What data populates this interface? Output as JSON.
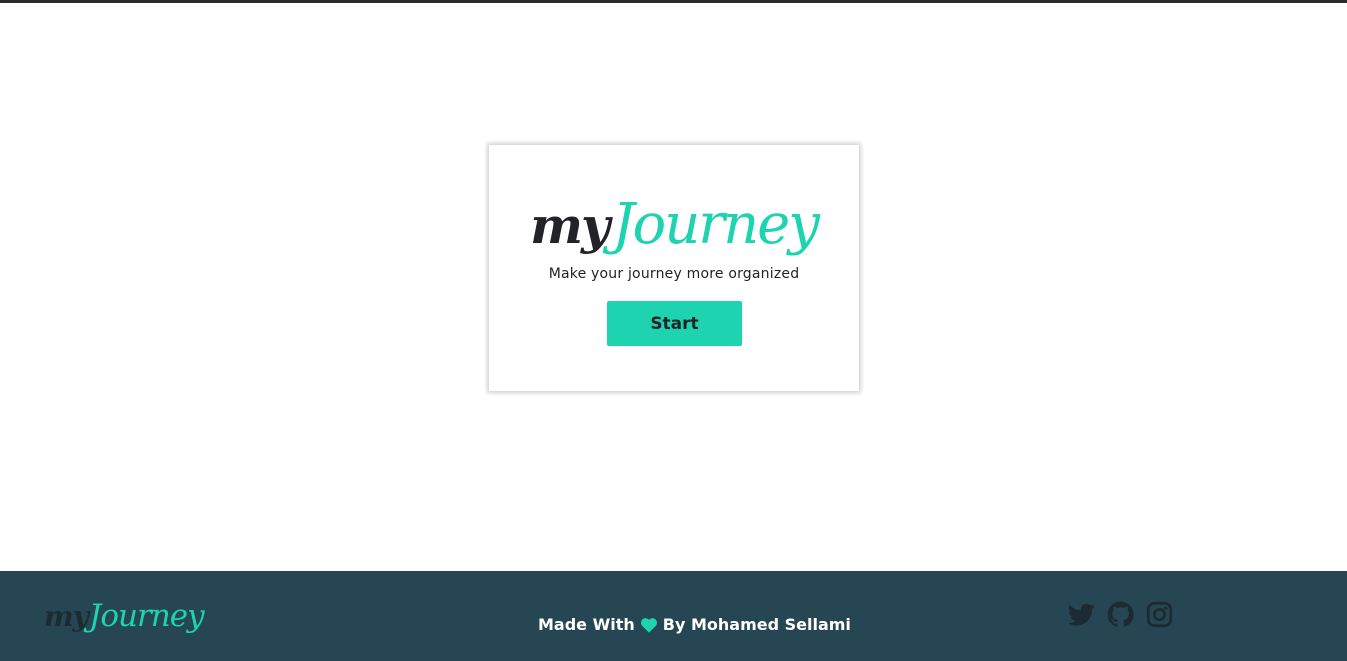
{
  "hero": {
    "logo_my": "my",
    "logo_journey": "Journey",
    "tagline": "Make your journey more organized",
    "start_label": "Start"
  },
  "footer": {
    "logo_my": "my",
    "logo_journey": "Journey",
    "made_with": "Made With",
    "by_author": "By Mohamed Sellami",
    "heart_icon": "heart-icon",
    "socials": [
      "twitter-icon",
      "github-icon",
      "instagram-icon"
    ]
  },
  "colors": {
    "accent": "#1dd3b0",
    "dark": "#222327",
    "footer_bg": "#264653"
  }
}
